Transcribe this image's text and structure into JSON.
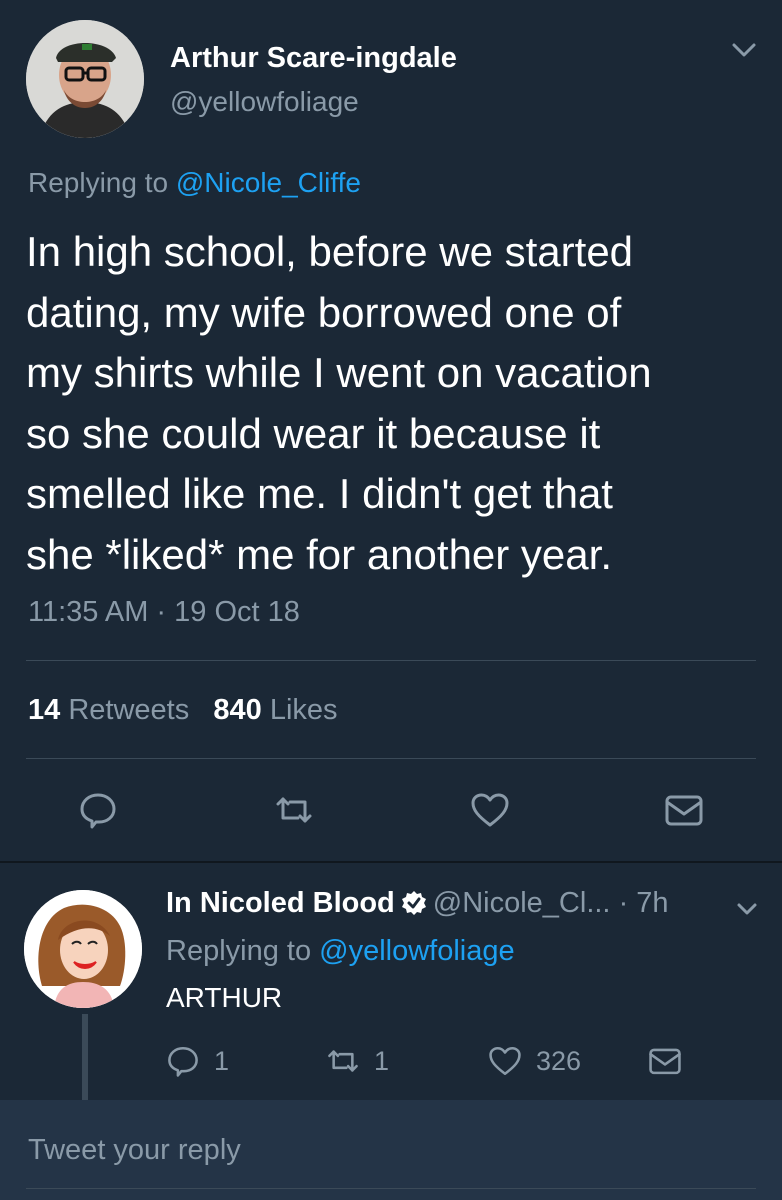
{
  "tweet": {
    "author_name": "Arthur Scare-ingdale",
    "author_handle": "@yellowfoliage",
    "replying_prefix": "Replying to",
    "replying_to": "@Nicole_Cliffe",
    "text": "In high school, before we started\ndating, my wife borrowed one of\nmy shirts while I went on vacation\nso she could wear it because it\nsmelled like me. I didn't get that\nshe *liked* me for another year.",
    "timestamp": "11:35 AM · 19 Oct 18",
    "retweets_count": "14",
    "retweets_label": "Retweets",
    "likes_count": "840",
    "likes_label": "Likes",
    "icons": [
      "reply-icon",
      "retweet-icon",
      "like-icon",
      "dm-icon",
      "chevron-down-icon"
    ]
  },
  "reply": {
    "author_name": "In Nicoled Blood",
    "author_handle": "@Nicole_Cl...",
    "age": "· 7h",
    "replying_prefix": "Replying to",
    "replying_to": "@yellowfoliage",
    "text": "ARTHUR",
    "reply_count": "1",
    "retweet_count": "1",
    "like_count": "326",
    "icons": [
      "verified-icon",
      "reply-icon",
      "retweet-icon",
      "like-icon",
      "dm-icon",
      "chevron-down-icon"
    ]
  },
  "compose": {
    "placeholder": "Tweet your reply"
  },
  "colors": {
    "background": "#1b2836",
    "link": "#1da1f2",
    "muted": "#8a9aa8",
    "compose_bg": "#243447"
  }
}
